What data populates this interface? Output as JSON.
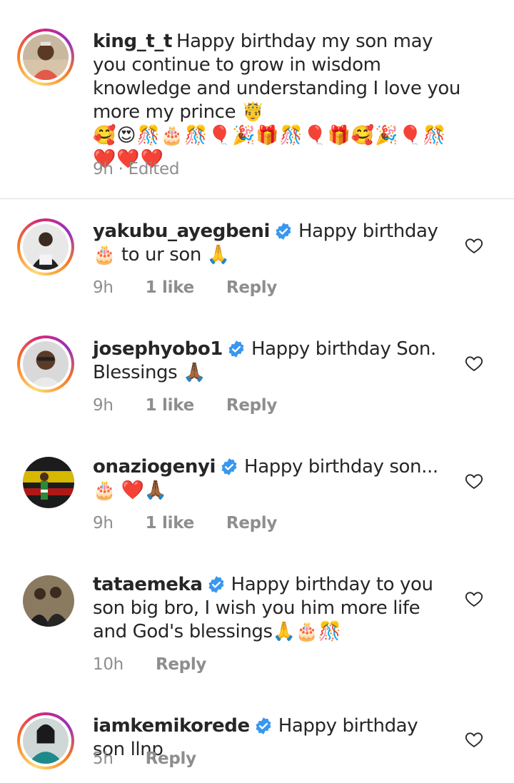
{
  "comments": [
    {
      "username": "king_t_t",
      "verified": false,
      "text": "Happy birthday my son may you continue to grow in wisdom knowledge and understanding I love you more my prince 🤴",
      "emojis": "🥰😍🎊🎂🎊🎈🎉🎁🎊🎈🎁🥰🎉🎈🎊❤️❤️❤️",
      "time": "9h · Edited",
      "likes": "",
      "reply": ""
    },
    {
      "username": "yakubu_ayegbeni",
      "verified": true,
      "text": "Happy birthday 🎂 to ur son 🙏",
      "time": "9h",
      "likes": "1 like",
      "reply": "Reply"
    },
    {
      "username": "josephyobo1",
      "verified": true,
      "text": "Happy birthday Son. Blessings 🙏🏾",
      "time": "9h",
      "likes": "1 like",
      "reply": "Reply"
    },
    {
      "username": "onaziogenyi",
      "verified": true,
      "text": "Happy birthday son... 🎂 ❤️🙏🏾",
      "time": "9h",
      "likes": "1 like",
      "reply": "Reply"
    },
    {
      "username": "tataemeka",
      "verified": true,
      "text": "Happy birthday to you son big bro, I wish you him more life and God's blessings🙏🎂🎊",
      "time": "10h",
      "likes": "",
      "reply": "Reply"
    },
    {
      "username": "iamkemikorede",
      "verified": true,
      "text": "Happy birthday son llnp",
      "time": "5h",
      "likes": "",
      "reply": "Reply"
    }
  ],
  "colors": {
    "verified_blue": "#3897f0",
    "meta_gray": "#8e8e8e",
    "text": "#262626",
    "divider": "#dbdbdb"
  },
  "icons": {
    "like": "heart-outline-icon",
    "verified": "verified-badge-icon"
  }
}
